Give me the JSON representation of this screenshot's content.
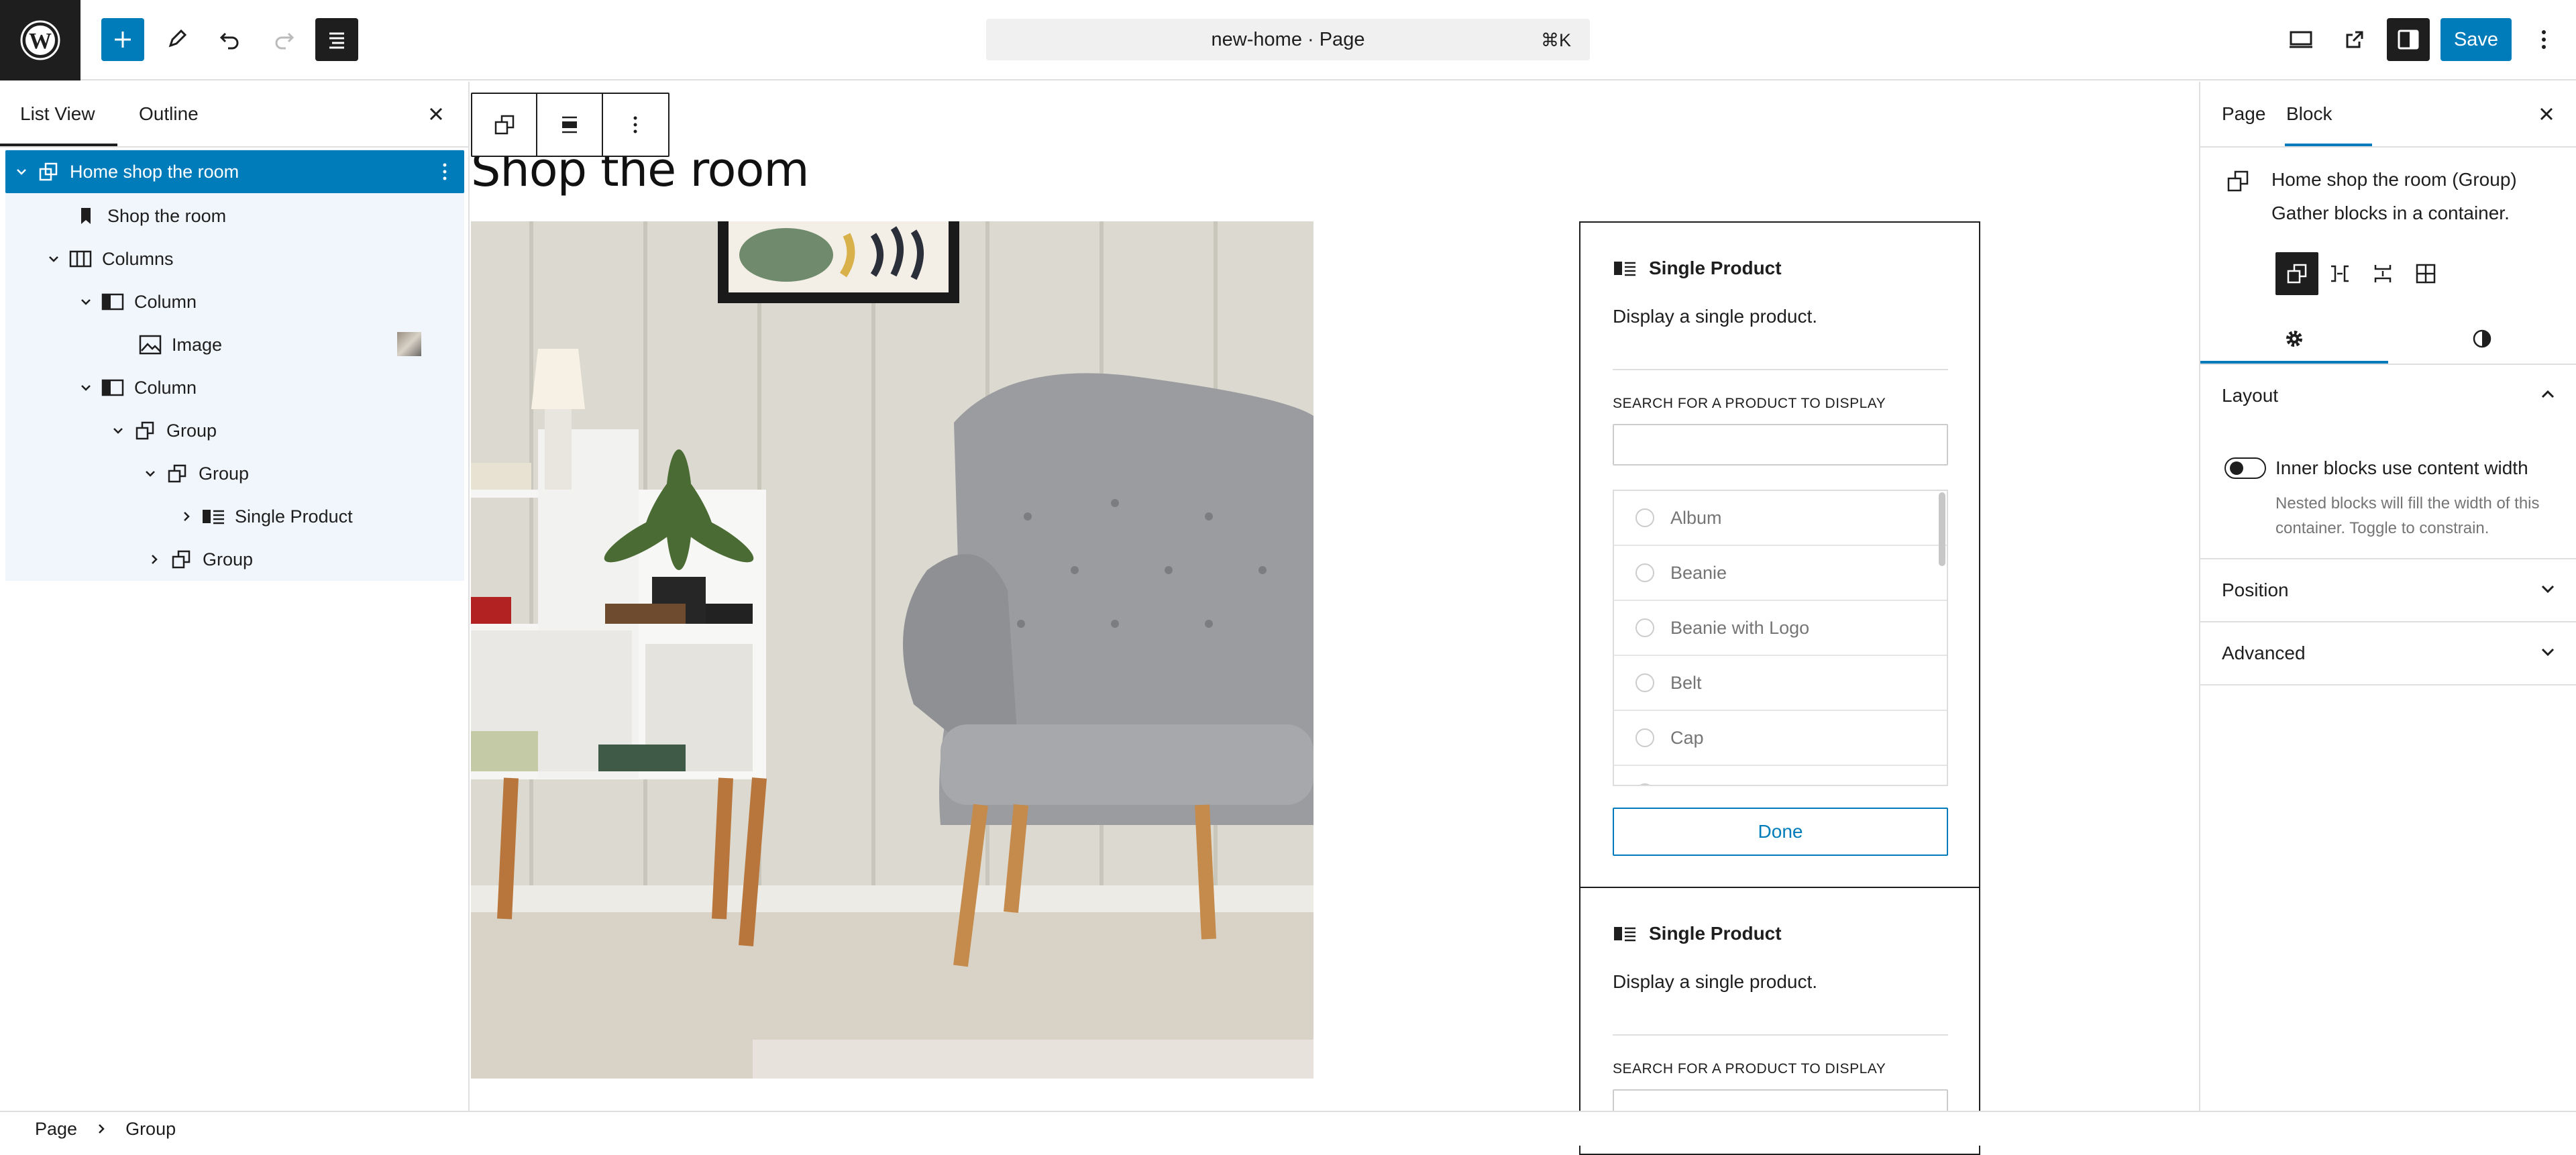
{
  "header": {
    "command_center": "new-home · Page",
    "shortcut": "⌘K",
    "save_label": "Save"
  },
  "left_panel": {
    "tabs": [
      "List View",
      "Outline"
    ],
    "tree": [
      {
        "label": "Home shop the room",
        "icon": "group-icon",
        "selected": true
      },
      {
        "label": "Shop the room",
        "icon": "bookmark-icon"
      },
      {
        "label": "Columns",
        "icon": "columns-icon"
      },
      {
        "label": "Column",
        "icon": "column-icon"
      },
      {
        "label": "Image",
        "icon": "image-icon"
      },
      {
        "label": "Column",
        "icon": "column-icon"
      },
      {
        "label": "Group",
        "icon": "group-icon"
      },
      {
        "label": "Group",
        "icon": "group-icon"
      },
      {
        "label": "Single Product",
        "icon": "product-icon"
      },
      {
        "label": "Group",
        "icon": "group-icon"
      }
    ]
  },
  "canvas": {
    "heading": "Shop the room",
    "card1": {
      "title": "Single Product",
      "description": "Display a single product.",
      "search_label": "SEARCH FOR A PRODUCT TO DISPLAY",
      "products": [
        "Album",
        "Beanie",
        "Beanie with Logo",
        "Belt",
        "Cap"
      ],
      "done_label": "Done"
    },
    "card2": {
      "title": "Single Product",
      "description": "Display a single product.",
      "search_label": "SEARCH FOR A PRODUCT TO DISPLAY"
    }
  },
  "right_panel": {
    "tabs": [
      "Page",
      "Block"
    ],
    "block_title": "Home shop the room (Group)",
    "block_desc": "Gather blocks in a container.",
    "sections": {
      "layout": "Layout",
      "position": "Position",
      "advanced": "Advanced"
    },
    "toggle_label": "Inner blocks use content width",
    "toggle_help": "Nested blocks will fill the width of this container. Toggle to constrain."
  },
  "breadcrumb": [
    "Page",
    "Group"
  ],
  "colors": {
    "accent": "#007cba",
    "dark": "#1e1e1e",
    "tree_bg": "#f0f6fc"
  }
}
